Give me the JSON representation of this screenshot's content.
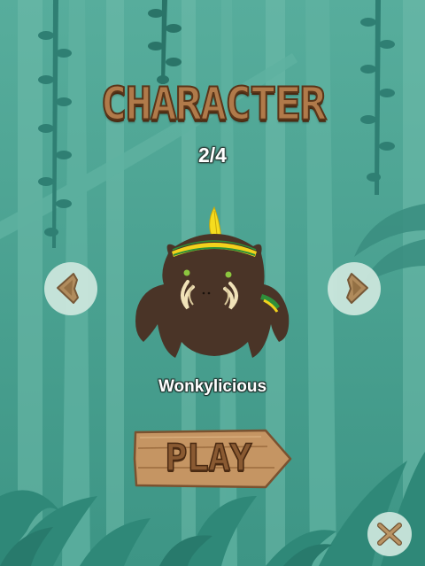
{
  "screen": {
    "title": "CHARACTER",
    "counter": "2/4",
    "character_name": "Wonkylicious",
    "play_label": "PLAY"
  },
  "colors": {
    "background": "#4fa595",
    "title_fill": "#b07a4a",
    "wood": "#b88a5a",
    "button_bg": "#cfe8df",
    "character_body": "#4a3427",
    "headband_yellow": "#f2d21c",
    "headband_green": "#2e8f3a"
  },
  "icons": {
    "prev": "arrow-left-icon",
    "next": "arrow-right-icon",
    "close": "close-x-icon"
  }
}
